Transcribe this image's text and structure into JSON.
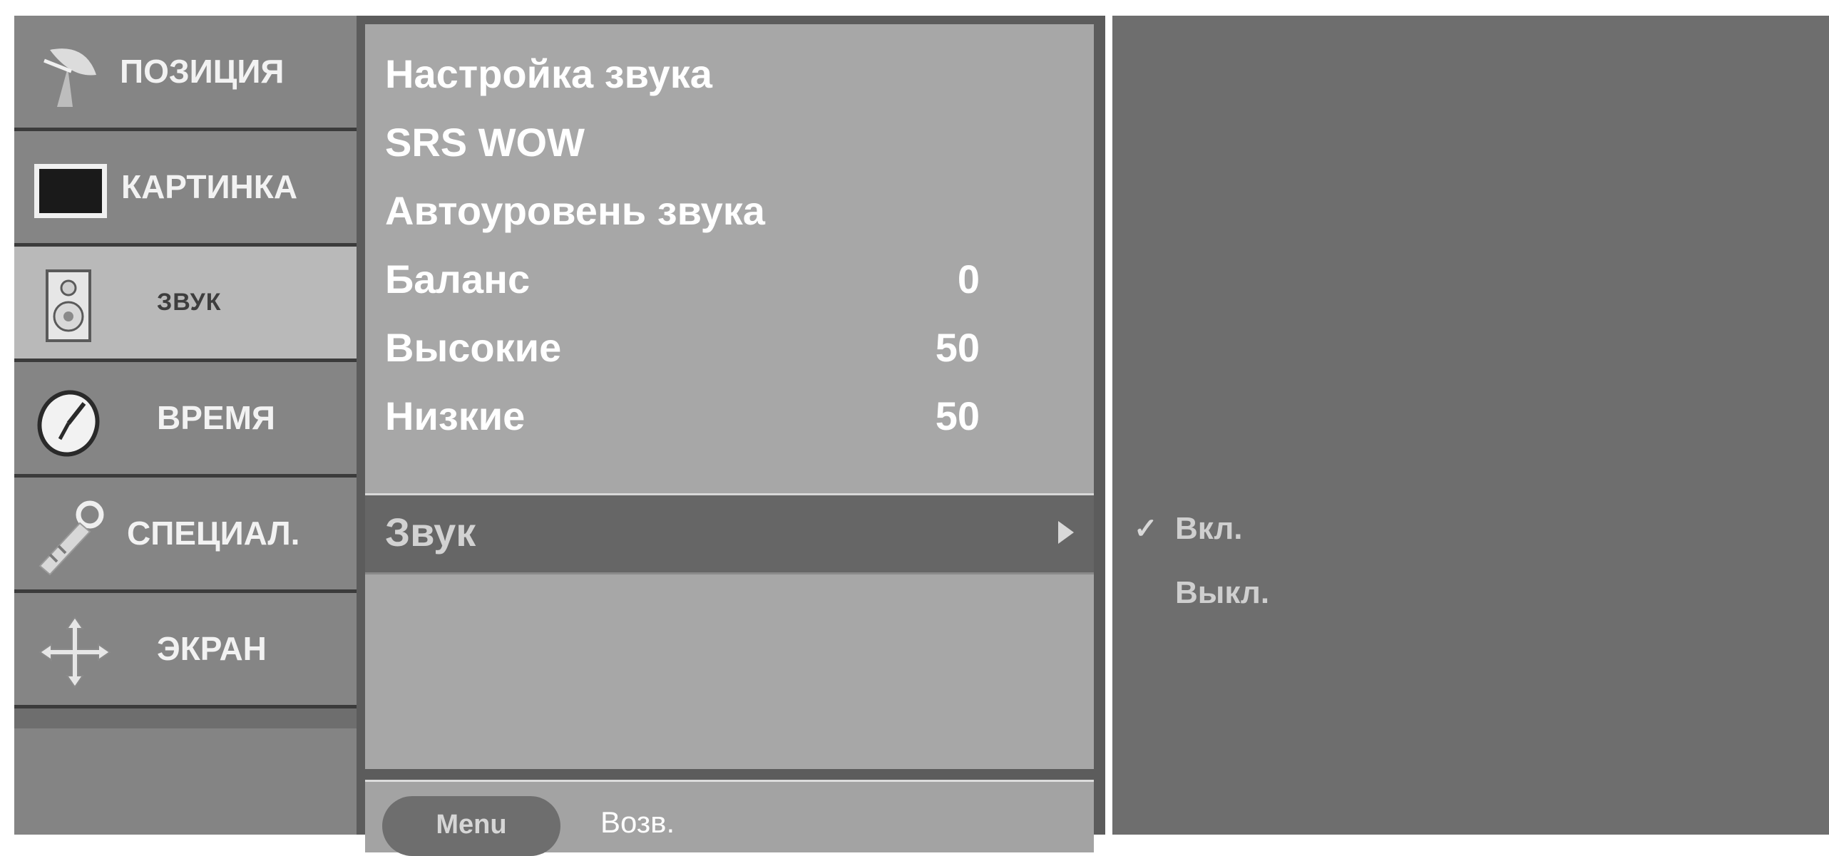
{
  "sidebar": {
    "items": [
      {
        "label": "ПОЗИЦИЯ",
        "icon": "satellite-dish-icon"
      },
      {
        "label": "КАРТИНКА",
        "icon": "tv-screen-icon"
      },
      {
        "label": "ЗВУК",
        "icon": "speaker-icon",
        "active": true
      },
      {
        "label": "ВРЕМЯ",
        "icon": "clock-icon"
      },
      {
        "label": "СПЕЦИАЛ.",
        "icon": "key-icon"
      },
      {
        "label": "ЭКРАН",
        "icon": "move-arrows-icon"
      }
    ]
  },
  "menu": {
    "items": [
      {
        "label": "Настройка звука",
        "value": ""
      },
      {
        "label": "SRS WOW",
        "value": ""
      },
      {
        "label": "Автоуровень звука",
        "value": ""
      },
      {
        "label": "Баланс",
        "value": "0"
      },
      {
        "label": "Высокие",
        "value": "50"
      },
      {
        "label": "Низкие",
        "value": "50"
      },
      {
        "label": "Звук",
        "value": "",
        "selected": true,
        "has_submenu": true
      }
    ]
  },
  "footer": {
    "menu_button": "Menu",
    "back_label": "Возв."
  },
  "submenu": {
    "options": [
      {
        "label": "Вкл.",
        "checked": true
      },
      {
        "label": "Выкл.",
        "checked": false
      }
    ]
  }
}
